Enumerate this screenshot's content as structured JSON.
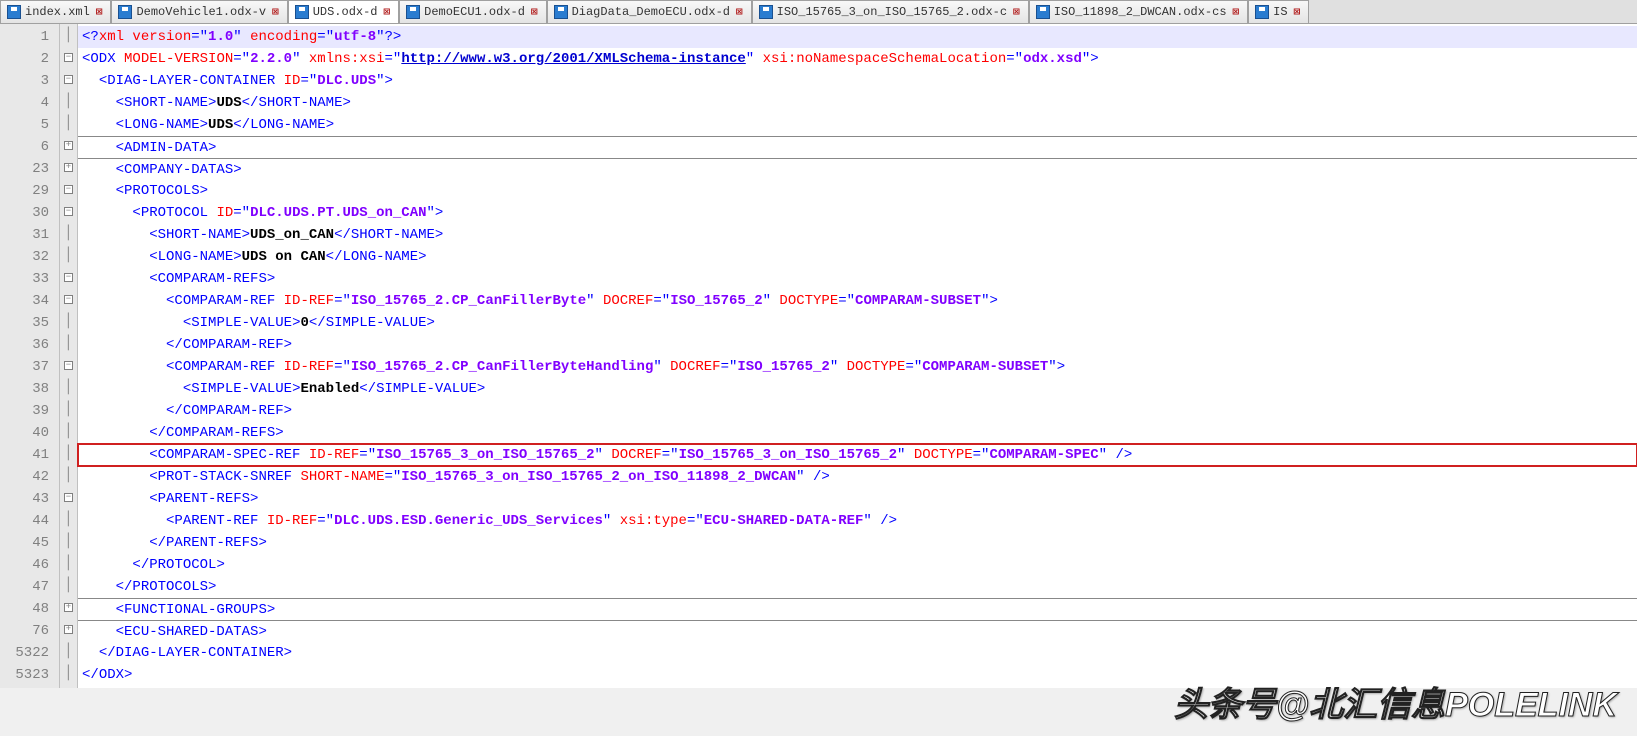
{
  "tabs": [
    {
      "label": "index.xml",
      "active": false
    },
    {
      "label": "DemoVehicle1.odx-v",
      "active": false
    },
    {
      "label": "UDS.odx-d",
      "active": true
    },
    {
      "label": "DemoECU1.odx-d",
      "active": false
    },
    {
      "label": "DiagData_DemoECU.odx-d",
      "active": false
    },
    {
      "label": "ISO_15765_3_on_ISO_15765_2.odx-c",
      "active": false
    },
    {
      "label": "ISO_11898_2_DWCAN.odx-cs",
      "active": false
    },
    {
      "label": "IS",
      "active": false
    }
  ],
  "gutter": [
    "1",
    "2",
    "3",
    "4",
    "5",
    "6",
    "23",
    "29",
    "30",
    "31",
    "32",
    "33",
    "34",
    "35",
    "36",
    "37",
    "38",
    "39",
    "40",
    "41",
    "42",
    "43",
    "44",
    "45",
    "46",
    "47",
    "48",
    "76",
    "5322",
    "5323"
  ],
  "fold": [
    "",
    "-",
    "-",
    "",
    "",
    "+",
    "+",
    "-",
    "-",
    "",
    "",
    "-",
    "-",
    "",
    "",
    "-",
    "",
    "",
    "",
    "",
    "",
    "-",
    "",
    "",
    "",
    "",
    "+",
    "+",
    "",
    ""
  ],
  "watermark": "头条号@北汇信息POLELINK",
  "xml": {
    "decl_version": "1.0",
    "decl_encoding": "utf-8",
    "odx_model_version": "2.2.0",
    "odx_xmlns_xsi": "http://www.w3.org/2001/XMLSchema-instance",
    "odx_schema_loc": "odx.xsd",
    "dlc_id": "DLC.UDS",
    "short_name": "UDS",
    "long_name": "UDS",
    "protocol_id": "DLC.UDS.PT.UDS_on_CAN",
    "proto_short": "UDS_on_CAN",
    "proto_long": "UDS on CAN",
    "cp1_idref": "ISO_15765_2.CP_CanFillerByte",
    "cp1_docref": "ISO_15765_2",
    "cp1_doctype": "COMPARAM-SUBSET",
    "cp1_value": "0",
    "cp2_idref": "ISO_15765_2.CP_CanFillerByteHandling",
    "cp2_docref": "ISO_15765_2",
    "cp2_doctype": "COMPARAM-SUBSET",
    "cp2_value": "Enabled",
    "spec_idref": "ISO_15765_3_on_ISO_15765_2",
    "spec_docref": "ISO_15765_3_on_ISO_15765_2",
    "spec_doctype": "COMPARAM-SPEC",
    "snref": "ISO_15765_3_on_ISO_15765_2_on_ISO_11898_2_DWCAN",
    "parent_idref": "DLC.UDS.ESD.Generic_UDS_Services",
    "parent_type": "ECU-SHARED-DATA-REF"
  }
}
